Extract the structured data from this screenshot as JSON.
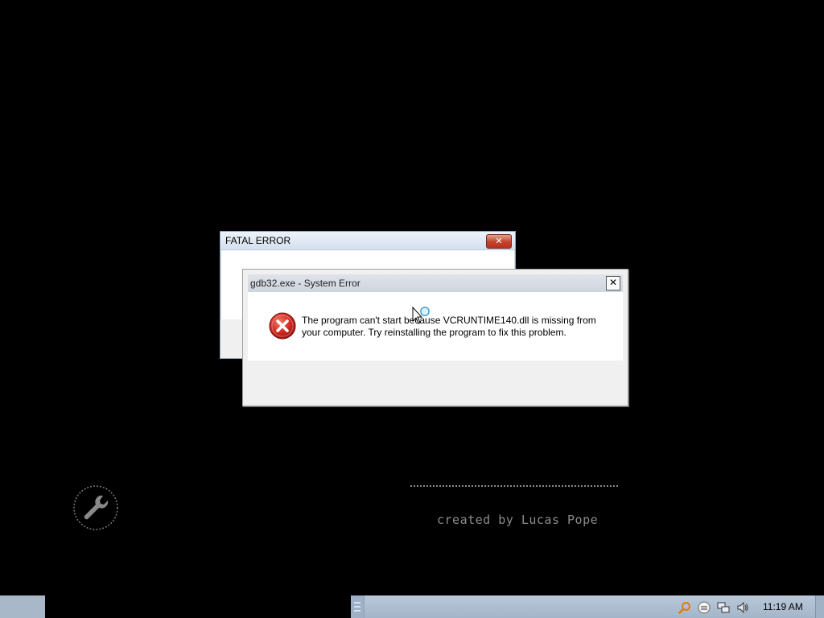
{
  "fatal_window": {
    "title": "FATAL ERROR",
    "close_glyph": "✕"
  },
  "system_error": {
    "title": "gdb32.exe - System Error",
    "close_glyph": "✕",
    "icon": "error-icon",
    "message": "The program can't start because VCRUNTIME140.dll is missing from your computer. Try reinstalling the program to fix this problem."
  },
  "desktop": {
    "credit": "created by Lucas Pope",
    "wrench_icon": "wrench-icon"
  },
  "taskbar": {
    "clock": "11:19 AM",
    "tray_icons": [
      "search-icon",
      "chat-icon",
      "network-icon",
      "volume-icon"
    ]
  },
  "colors": {
    "error_red": "#c8292a",
    "taskbar": "#b0c1d3",
    "credit_gray": "#8c8c8c"
  }
}
